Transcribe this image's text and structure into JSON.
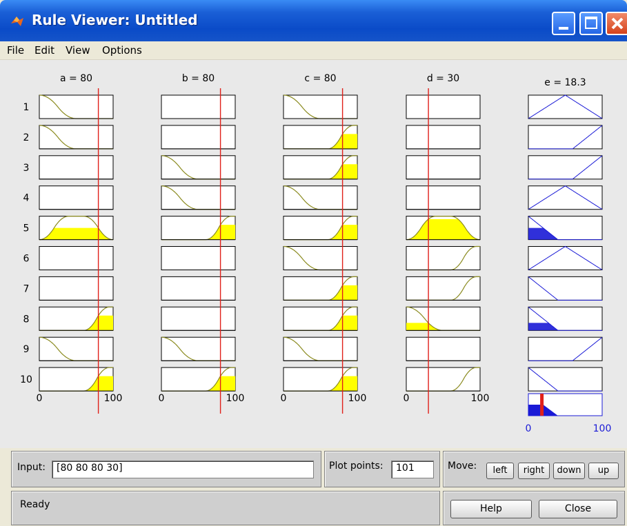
{
  "window": {
    "title": "Rule Viewer: Untitled",
    "colors": {
      "titlebar": "#0a4bc8",
      "rule_line": "#e0201a",
      "fill": "#ffff00",
      "output_line": "#1a1ad6",
      "curve": "#8b8b20"
    }
  },
  "menu": [
    "File",
    "Edit",
    "View",
    "Options"
  ],
  "inputs": [
    {
      "label": "a = 80",
      "value": 80,
      "range": [
        0,
        100
      ],
      "range_labels": [
        "0",
        "100"
      ]
    },
    {
      "label": "b = 80",
      "value": 80,
      "range": [
        0,
        100
      ],
      "range_labels": [
        "0",
        "100"
      ]
    },
    {
      "label": "c = 80",
      "value": 80,
      "range": [
        0,
        100
      ],
      "range_labels": [
        "0",
        "100"
      ]
    },
    {
      "label": "d = 30",
      "value": 30,
      "range": [
        0,
        100
      ],
      "range_labels": [
        "0",
        "100"
      ]
    }
  ],
  "output": {
    "label": "e = 18.3",
    "value": 18.3,
    "range": [
      0,
      100
    ],
    "range_labels": [
      "0",
      "100"
    ]
  },
  "rules": [
    {
      "number": "1",
      "a": "low",
      "b": "none",
      "c": "low",
      "d": "none",
      "e": "mid"
    },
    {
      "number": "2",
      "a": "low",
      "b": "none",
      "c": "high",
      "d": "none",
      "e": "high"
    },
    {
      "number": "3",
      "a": "none",
      "b": "low",
      "c": "high",
      "d": "none",
      "e": "high"
    },
    {
      "number": "4",
      "a": "none",
      "b": "low",
      "c": "low",
      "d": "none",
      "e": "mid"
    },
    {
      "number": "5",
      "a": "mid",
      "b": "high",
      "c": "high",
      "d": "mid",
      "e": "low"
    },
    {
      "number": "6",
      "a": "none",
      "b": "none",
      "c": "low",
      "d": "high",
      "e": "mid"
    },
    {
      "number": "7",
      "a": "none",
      "b": "none",
      "c": "high",
      "d": "high",
      "e": "low"
    },
    {
      "number": "8",
      "a": "high",
      "b": "none",
      "c": "high",
      "d": "low",
      "e": "low"
    },
    {
      "number": "9",
      "a": "low",
      "b": "low",
      "c": "low",
      "d": "none",
      "e": "high"
    },
    {
      "number": "10",
      "a": "high",
      "b": "high",
      "c": "high",
      "d": "high",
      "e": "low"
    }
  ],
  "controls": {
    "input_label": "Input:",
    "input_value": "[80 80 80 30]",
    "plot_points_label": "Plot points:",
    "plot_points_value": "101",
    "move_label": "Move:",
    "move_buttons": [
      "left",
      "right",
      "down",
      "up"
    ],
    "status": "Ready",
    "help_label": "Help",
    "close_label": "Close"
  }
}
